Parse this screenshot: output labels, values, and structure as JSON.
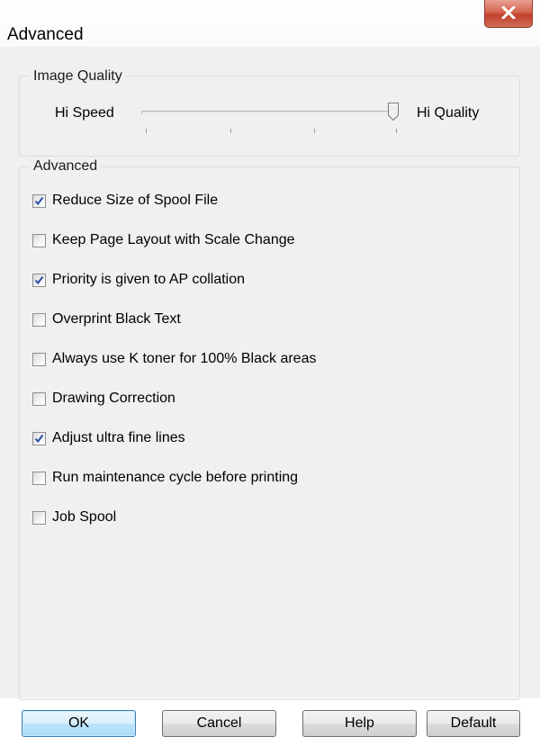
{
  "window": {
    "title": "Advanced",
    "close_icon": "close-icon"
  },
  "image_quality": {
    "group_label": "Image Quality",
    "left_label": "Hi Speed",
    "right_label": "Hi Quality",
    "slider_position": 1.0,
    "tick_count": 4
  },
  "advanced": {
    "group_label": "Advanced",
    "options": [
      {
        "label": "Reduce Size of Spool File",
        "checked": true
      },
      {
        "label": "Keep Page Layout with Scale Change",
        "checked": false
      },
      {
        "label": "Priority is given to AP collation",
        "checked": true
      },
      {
        "label": "Overprint Black Text",
        "checked": false
      },
      {
        "label": "Always use K toner for 100% Black areas",
        "checked": false
      },
      {
        "label": "Drawing Correction",
        "checked": false
      },
      {
        "label": "Adjust ultra fine lines",
        "checked": true
      },
      {
        "label": "Run maintenance cycle before printing",
        "checked": false
      },
      {
        "label": "Job Spool",
        "checked": false
      }
    ]
  },
  "buttons": {
    "ok": "OK",
    "cancel": "Cancel",
    "help": "Help",
    "default": "Default"
  },
  "colors": {
    "accent": "#3c7fb1",
    "checkmark": "#2a4fa8",
    "close_button": "#c7513e"
  }
}
